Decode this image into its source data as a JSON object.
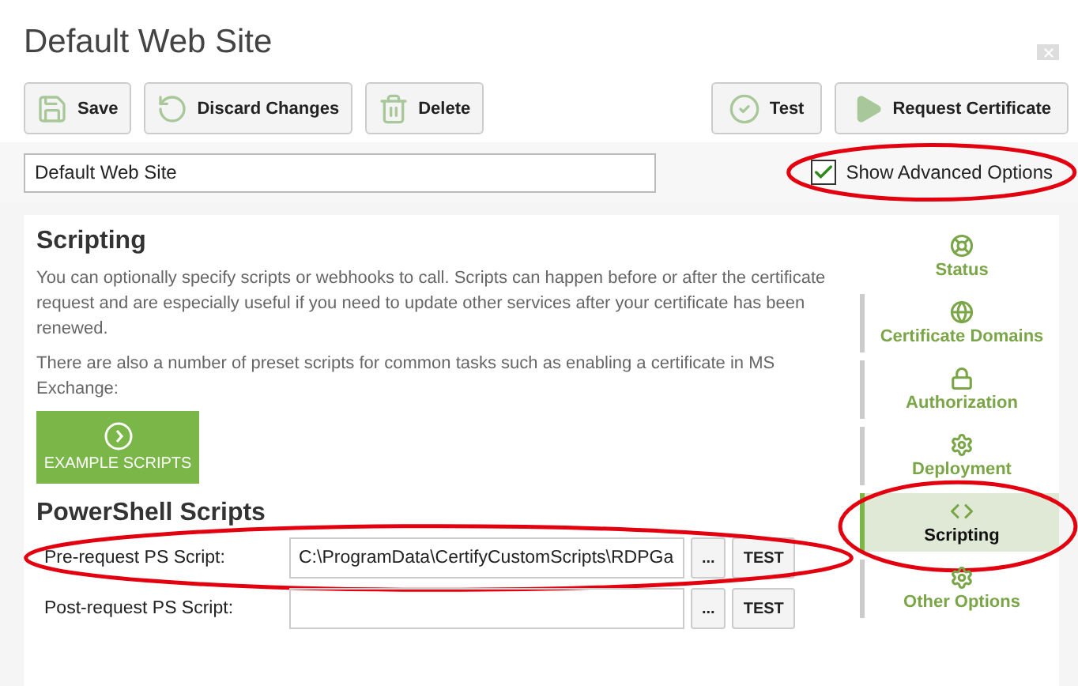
{
  "window": {
    "title": "Default Web Site"
  },
  "toolbar": {
    "left": [
      {
        "label": "Save"
      },
      {
        "label": "Discard Changes"
      },
      {
        "label": "Delete"
      }
    ],
    "right": [
      {
        "label": "Test"
      },
      {
        "label": "Request Certificate"
      }
    ]
  },
  "name_field": {
    "value": "Default Web Site"
  },
  "advanced_options": {
    "label": "Show Advanced Options",
    "checked": true,
    "highlighted": true
  },
  "section": {
    "title": "Scripting",
    "paragraphs": [
      "You can optionally specify scripts or webhooks to call. Scripts can happen before or after the certificate request and are especially useful if you need to update other services after your certificate has been renewed.",
      "There are also a number of preset scripts for common tasks such as enabling a certificate in MS Exchange:"
    ],
    "example_button": "EXAMPLE SCRIPTS"
  },
  "powershell": {
    "title": "PowerShell Scripts",
    "rows": [
      {
        "label": "Pre-request PS Script:",
        "value": "C:\\ProgramData\\CertifyCustomScripts\\RDPGa",
        "browse": "...",
        "test": "TEST",
        "highlighted": true
      },
      {
        "label": "Post-request PS Script:",
        "browse": "...",
        "test": "TEST",
        "highlighted": false
      }
    ]
  },
  "sidebar": {
    "items": [
      {
        "label": "Status",
        "selected": false,
        "highlighted": false
      },
      {
        "label": "Certificate Domains",
        "selected": false,
        "highlighted": false
      },
      {
        "label": "Authorization",
        "selected": false,
        "highlighted": false
      },
      {
        "label": "Deployment",
        "selected": false,
        "highlighted": false
      },
      {
        "label": "Scripting",
        "selected": true,
        "highlighted": true
      },
      {
        "label": "Other Options",
        "selected": false,
        "highlighted": false
      }
    ]
  }
}
